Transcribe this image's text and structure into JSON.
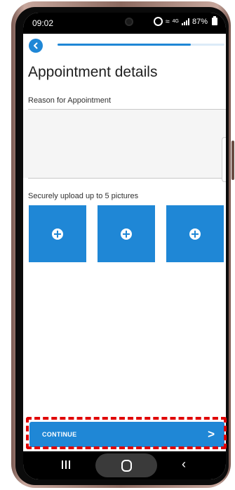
{
  "status_bar": {
    "time": "09:02",
    "battery_text": "87%"
  },
  "header": {
    "title": "Appointment details",
    "progress": 0.8
  },
  "form": {
    "reason_label": "Reason for Appointment",
    "reason_value": "",
    "upload_label": "Securely upload up to 5 pictures",
    "upload_slots": 3
  },
  "footer": {
    "continue_label": "CONTINUE",
    "continue_icon": "chevron-right-icon"
  },
  "colors": {
    "accent": "#1f87d6",
    "highlight": "#e00000"
  }
}
